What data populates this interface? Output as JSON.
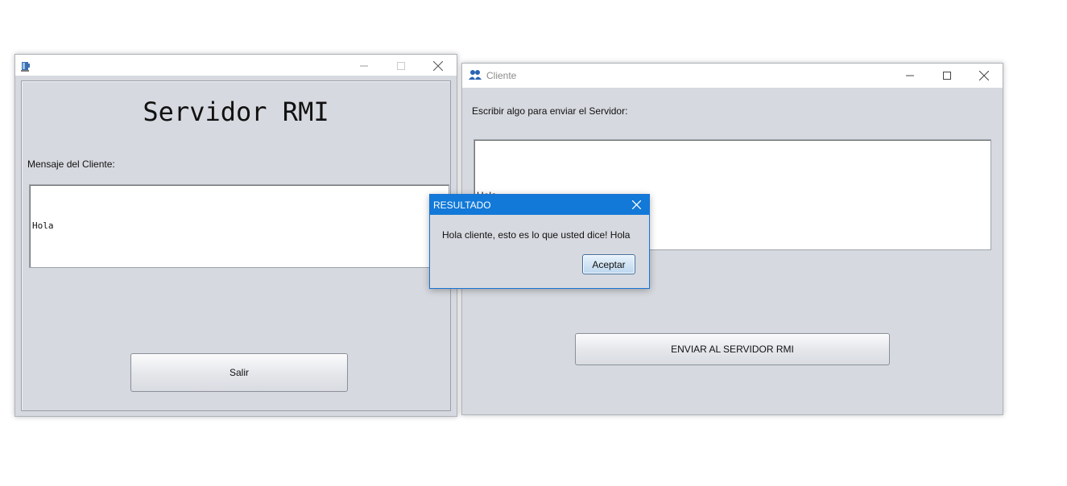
{
  "server_window": {
    "title": "",
    "heading": "Servidor RMI",
    "message_label": "Mensaje del Cliente:",
    "message_value": "Hola",
    "exit_button": "Salir"
  },
  "client_window": {
    "title": "Cliente",
    "prompt_label": "Escribir algo para enviar el Servidor:",
    "input_value": "Hola",
    "send_button": "ENVIAR AL SERVIDOR RMI"
  },
  "dialog": {
    "title": "RESULTADO",
    "message": "Hola cliente, esto es lo que usted dice! Hola",
    "ok_button": "Aceptar"
  },
  "colors": {
    "window_bg": "#d6d9df",
    "dialog_titlebar": "#1279d8"
  },
  "icons": {
    "server_app": "java-cup-icon",
    "client_app": "people-icon",
    "minimize": "minimize-icon",
    "maximize": "maximize-icon",
    "close": "close-icon"
  }
}
